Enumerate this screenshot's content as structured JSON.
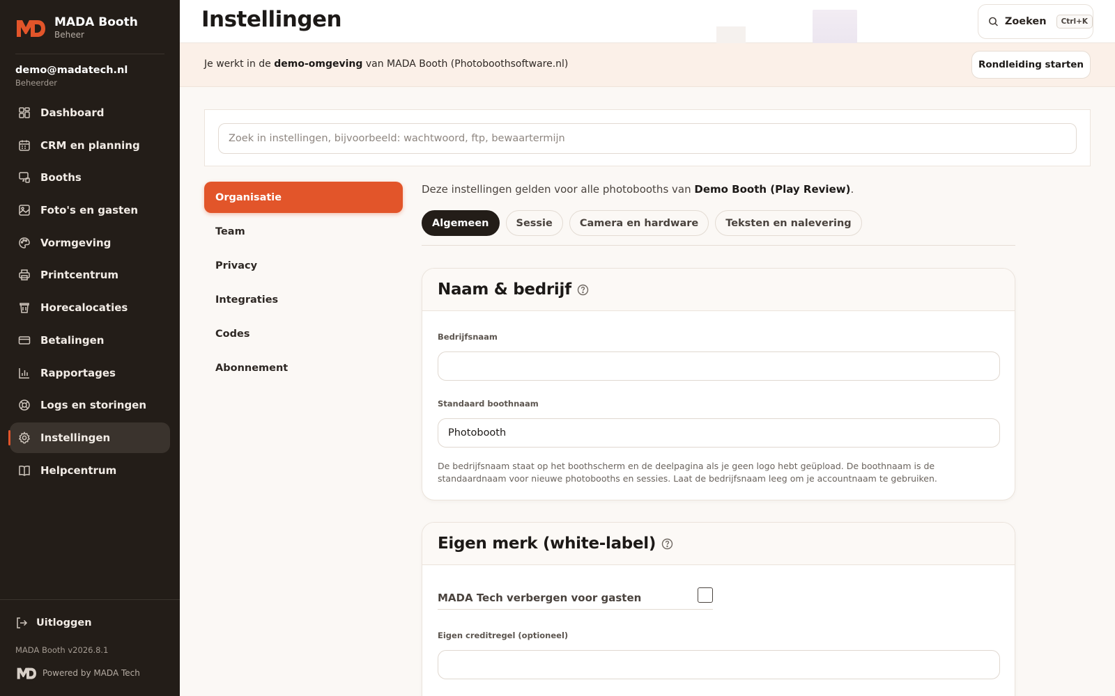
{
  "brand": {
    "name": "MADA Booth",
    "subtitle": "Beheer"
  },
  "user": {
    "email": "demo@madatech.nl",
    "role": "Beheerder"
  },
  "sidebar": {
    "items": [
      {
        "label": "Dashboard",
        "icon": "dashboard-grid-icon"
      },
      {
        "label": "CRM en planning",
        "icon": "calendar-icon"
      },
      {
        "label": "Booths",
        "icon": "booth-monitor-icon"
      },
      {
        "label": "Foto's en gasten",
        "icon": "image-icon"
      },
      {
        "label": "Vormgeving",
        "icon": "palette-icon"
      },
      {
        "label": "Printcentrum",
        "icon": "printer-icon"
      },
      {
        "label": "Horecalocaties",
        "icon": "cup-icon"
      },
      {
        "label": "Betalingen",
        "icon": "credit-card-icon"
      },
      {
        "label": "Rapportages",
        "icon": "bar-chart-icon"
      },
      {
        "label": "Logs en storingen",
        "icon": "lifebuoy-icon"
      },
      {
        "label": "Instellingen",
        "icon": "gear-icon",
        "active": true
      },
      {
        "label": "Helpcentrum",
        "icon": "book-icon"
      }
    ],
    "logout_label": "Uitloggen",
    "version": "MADA Booth v2026.8.1",
    "powered_by": "Powered by MADA Tech"
  },
  "header": {
    "title": "Instellingen",
    "search_label": "Zoeken",
    "search_shortcut": "Ctrl+K"
  },
  "banner": {
    "prefix": "Je werkt in de ",
    "emphasis": "demo-omgeving",
    "suffix": " van MADA Booth (Photoboothsoftware.nl)",
    "tour_button": "Rondleiding starten"
  },
  "settings_search": {
    "placeholder": "Zoek in instellingen, bijvoorbeeld: wachtwoord, ftp, bewaartermijn",
    "value": ""
  },
  "sections": [
    {
      "label": "Organisatie",
      "active": true
    },
    {
      "label": "Team"
    },
    {
      "label": "Privacy"
    },
    {
      "label": "Integraties"
    },
    {
      "label": "Codes"
    },
    {
      "label": "Abonnement"
    }
  ],
  "scope": {
    "prefix": "Deze instellingen gelden voor alle photobooths van ",
    "account": "Demo Booth (Play Review)",
    "suffix": "."
  },
  "tabs": [
    {
      "label": "Algemeen",
      "active": true
    },
    {
      "label": "Sessie"
    },
    {
      "label": "Camera en hardware"
    },
    {
      "label": "Teksten en nalevering"
    }
  ],
  "card_name": {
    "title": "Naam & bedrijf",
    "company_label": "Bedrijfsnaam",
    "company_value": "",
    "booth_label": "Standaard boothnaam",
    "booth_value": "Photobooth",
    "help": "De bedrijfsnaam staat op het boothscherm en de deelpagina als je geen logo hebt geüpload. De boothnaam is de standaardnaam voor nieuwe photobooths en sessies. Laat de bedrijfsnaam leeg om je accountnaam te gebruiken."
  },
  "card_brand": {
    "title": "Eigen merk (white-label)",
    "hide_label": "MADA Tech verbergen voor gasten",
    "hide_checked": false,
    "credit_label": "Eigen creditregel (optioneel)",
    "credit_value": ""
  },
  "colors": {
    "accent": "#e2552a",
    "sidebar_bg": "#231d18",
    "page_bg": "#fbf8f5"
  }
}
